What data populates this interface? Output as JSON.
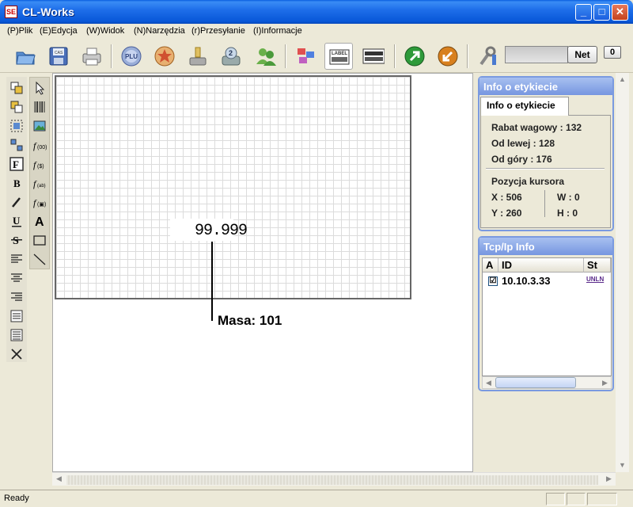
{
  "window": {
    "title": "CL-Works",
    "app_icon": "cl-works-logo-icon",
    "min": "_",
    "max": "□",
    "close": "✕"
  },
  "menu": {
    "items": [
      {
        "label": "(P)Plik"
      },
      {
        "label": "(E)Edycja"
      },
      {
        "label": "(W)Widok"
      },
      {
        "label": "(N)Narzędzia"
      },
      {
        "label": "(r)Przesyłanie"
      },
      {
        "label": "(I)Informacje"
      }
    ]
  },
  "toolbar": {
    "icons": [
      "open-folder-icon",
      "save-cas-icon",
      "print-icon",
      "plu-icon",
      "star-icon",
      "download-icon",
      "scale-2-icon",
      "users-icon",
      "tags-icon",
      "label-icon",
      "barcode-board-icon",
      "send-green-icon",
      "receive-orange-icon",
      "settings-tools-icon"
    ],
    "net_label": "Net",
    "counter": "0"
  },
  "palette": {
    "col1": [
      "bring-front-icon",
      "send-back-icon",
      "group-icon",
      "ungroup-icon",
      "font-f-icon",
      "bold-icon",
      "italic-icon",
      "underline-icon",
      "strike-icon",
      "align-left-icon",
      "align-center-icon",
      "align-right-icon",
      "justify-icon",
      "justify-all-icon",
      "delete-x-icon"
    ],
    "col2": [
      "pointer-icon",
      "barcode-icon",
      "image-icon",
      "function-00-icon",
      "function-dollar-icon",
      "function-text-icon",
      "function-image-icon",
      "text-a-icon",
      "rectangle-icon",
      "line-icon"
    ]
  },
  "label": {
    "field_value": "99.999",
    "masa_label": "Masa:  101"
  },
  "info_panel": {
    "title": "Info o etykiecie",
    "tab": "Info o etykiecie",
    "lines": {
      "rabat": "Rabat wagowy : 132",
      "left": "Od lewej : 128",
      "top": "Od góry : 176",
      "cursor_title": "Pozycja kursora",
      "x": "X : 506",
      "w": "W : 0",
      "y": "Y : 260",
      "h": "H : 0"
    }
  },
  "tcp_panel": {
    "title": "Tcp/Ip Info",
    "columns": [
      "A",
      "ID",
      "St"
    ],
    "rows": [
      {
        "checked": "☑",
        "id": "10.10.3.33",
        "status": "UNLN"
      }
    ]
  },
  "status": {
    "text": "Ready"
  }
}
